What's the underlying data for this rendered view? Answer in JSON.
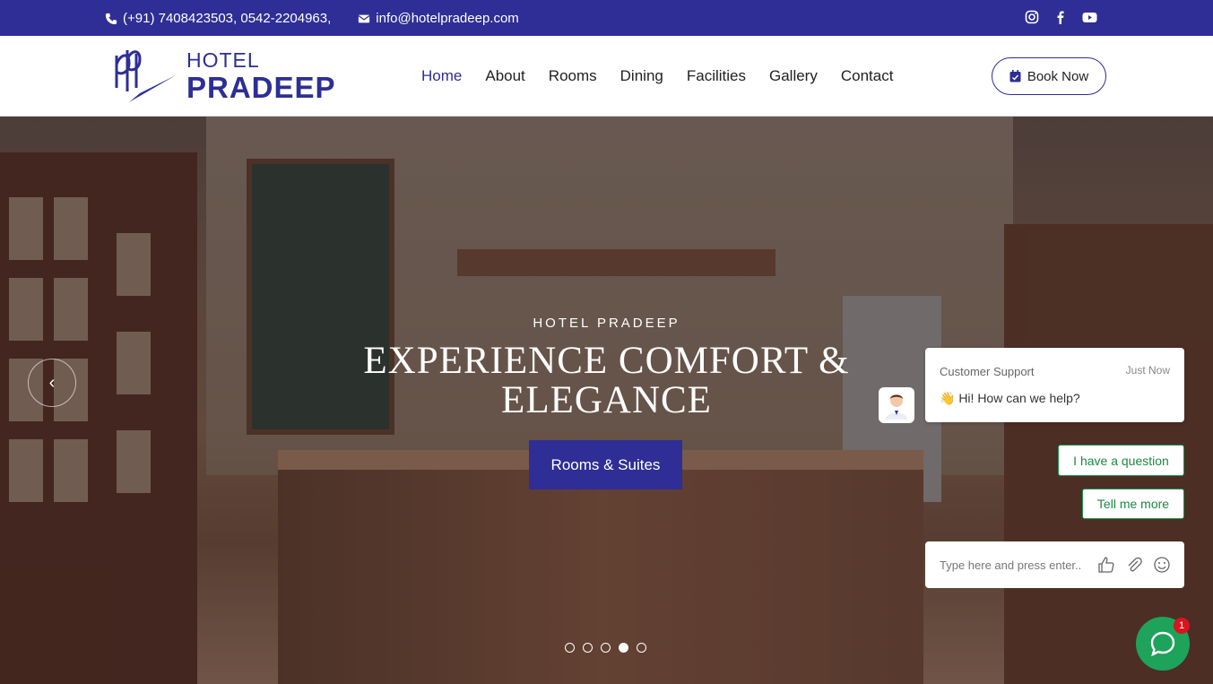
{
  "topbar": {
    "phone": "(+91) 7408423503, 0542-2204963,",
    "email": "info@hotelpradeep.com",
    "social_icons": [
      "instagram-icon",
      "facebook-icon",
      "youtube-icon"
    ],
    "bg_color": "#2e2e96"
  },
  "logo": {
    "hotel": "HOTEL",
    "name": "PRADEEP"
  },
  "nav": {
    "items": [
      "Home",
      "About",
      "Rooms",
      "Dining",
      "Facilities",
      "Gallery",
      "Contact"
    ],
    "active": "Home"
  },
  "book_button": {
    "label": "Book Now"
  },
  "hero": {
    "subtitle": "HOTEL PRADEEP",
    "title_line1": "EXPERIENCE COMFORT &",
    "title_line2": "ELEGANCE",
    "button": "Rooms & Suites",
    "prev_arrow": "‹",
    "slide_count": 5,
    "active_slide": 4
  },
  "chat": {
    "agent_name": "Customer Support",
    "time": "Just Now",
    "message": "👋 Hi! How can we help?",
    "quick_reply_1": "I have a question",
    "quick_reply_2": "Tell me more",
    "input_placeholder": "Type here and press enter..",
    "badge_count": "1",
    "accent_color": "#1ea35a"
  }
}
